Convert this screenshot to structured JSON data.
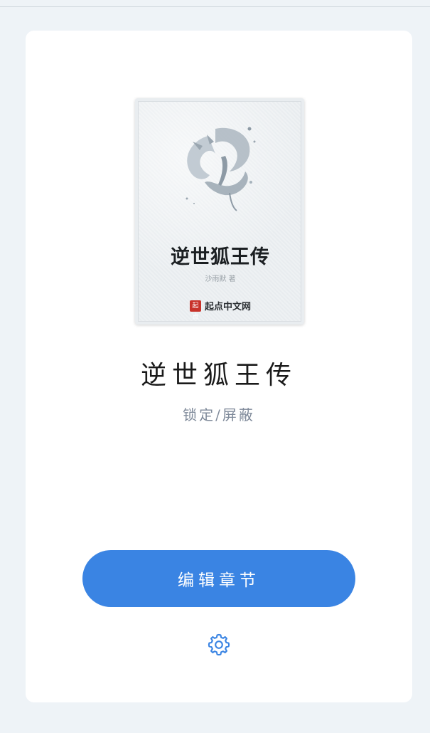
{
  "book": {
    "cover": {
      "title": "逆世狐王传",
      "author": "沙雨默 著",
      "publisher_logo": "起点",
      "publisher": "起点中文网",
      "publisher_logo_color": "#c8332b"
    },
    "title": "逆世狐王传",
    "status": "锁定/屏蔽"
  },
  "actions": {
    "edit_label": "编辑章节",
    "edit_color": "#3a84e3",
    "settings_icon": "gear-icon",
    "settings_color": "#3a84e3"
  }
}
